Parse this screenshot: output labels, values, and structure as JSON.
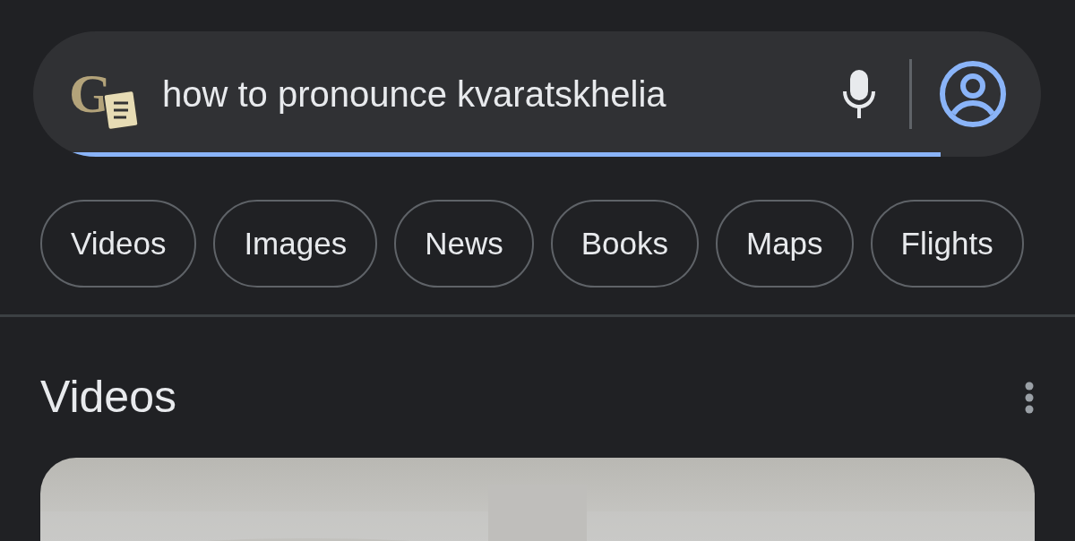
{
  "search": {
    "logo_letter": "G",
    "query": "how to pronounce kvaratskhelia",
    "loading": {
      "level": 0.9
    }
  },
  "chips": [
    {
      "label": "Videos"
    },
    {
      "label": "Images"
    },
    {
      "label": "News"
    },
    {
      "label": "Books"
    },
    {
      "label": "Maps"
    },
    {
      "label": "Flights"
    }
  ],
  "section": {
    "title": "Videos"
  }
}
